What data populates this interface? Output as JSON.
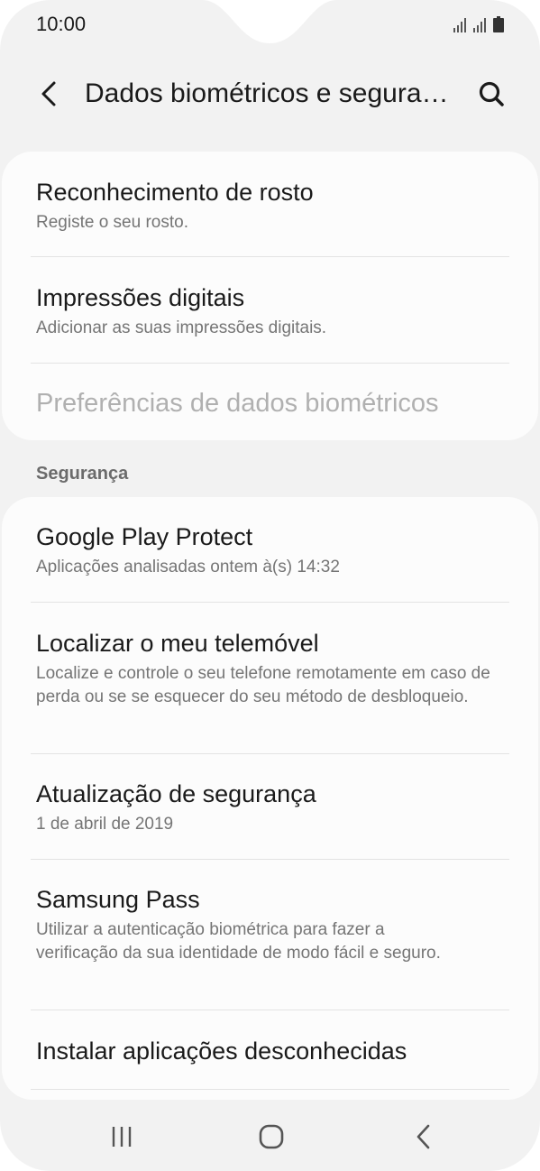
{
  "status_bar": {
    "time": "10:00"
  },
  "header": {
    "title": "Dados biométricos e segurança"
  },
  "biometrics": {
    "items": [
      {
        "title": "Reconhecimento de rosto",
        "subtitle": "Registe o seu rosto."
      },
      {
        "title": "Impressões digitais",
        "subtitle": "Adicionar as suas impressões digitais."
      },
      {
        "title": "Preferências de dados biométricos",
        "subtitle": ""
      }
    ]
  },
  "security": {
    "section_label": "Segurança",
    "items": [
      {
        "title": "Google Play Protect",
        "subtitle": "Aplicações analisadas ontem à(s) 14:32"
      },
      {
        "title": "Localizar o meu telemóvel",
        "subtitle": "Localize e controle o seu telefone remotamente em caso de perda ou se se esquecer do seu método de desbloqueio."
      },
      {
        "title": "Atualização de segurança",
        "subtitle": "1 de abril de 2019"
      },
      {
        "title": "Samsung Pass",
        "subtitle": "Utilizar a autenticação biométrica para fazer a verificação da sua identidade de modo fácil e seguro."
      },
      {
        "title": "Instalar aplicações desconhecidas",
        "subtitle": ""
      }
    ]
  },
  "icons": {
    "back": "back-arrow-icon",
    "search": "search-icon",
    "recents": "recents-icon",
    "home": "home-icon",
    "nav_back": "nav-back-icon",
    "signal": "signal-icon",
    "battery": "battery-icon"
  },
  "colors": {
    "background": "#f2f2f2",
    "card": "#fcfcfc",
    "text_primary": "#1a1a1a",
    "text_secondary": "#757575",
    "text_disabled": "#b0b0b0"
  }
}
